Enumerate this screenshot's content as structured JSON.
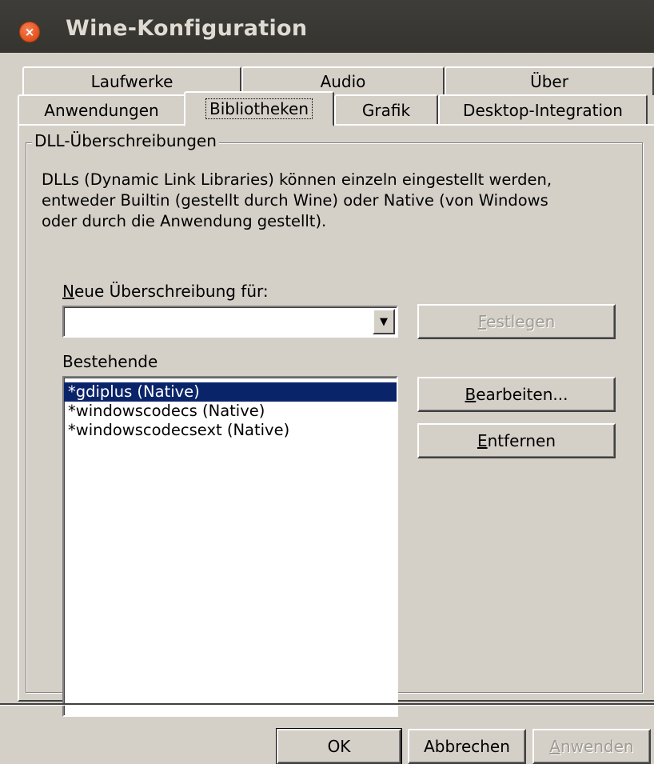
{
  "window": {
    "title": "Wine-Konfiguration",
    "close_glyph": "×",
    "close_color": "#e2511c"
  },
  "tabs": {
    "row1": [
      {
        "label": "Laufwerke"
      },
      {
        "label": "Audio"
      },
      {
        "label": "Über"
      }
    ],
    "row2": [
      {
        "label": "Anwendungen"
      },
      {
        "label": "Bibliotheken",
        "selected": true
      },
      {
        "label": "Grafik"
      },
      {
        "label": "Desktop-Integration"
      }
    ]
  },
  "dll": {
    "group_title": "DLL-Überschreibungen",
    "description": "DLLs (Dynamic Link Libraries) können einzeln eingestellt werden,\nentweder Builtin (gestellt durch Wine) oder Native (von Windows\noder durch die Anwendung gestellt).",
    "new_override_label_mnemonic": "N",
    "new_override_label_rest": "eue Überschreibung für:",
    "combo_value": "",
    "combo_arrow": "▼",
    "set_button_mnemonic": "F",
    "set_button_rest": "estlegen",
    "existing_label": "Bestehende",
    "existing": [
      {
        "label": "*gdiplus (Native)",
        "selected": true
      },
      {
        "label": "*windowscodecs (Native)"
      },
      {
        "label": "*windowscodecsext (Native)"
      }
    ],
    "edit_button_mnemonic": "B",
    "edit_button_rest": "earbeiten...",
    "remove_button_mnemonic": "E",
    "remove_button_rest": "ntfernen"
  },
  "footer": {
    "ok_label": "OK",
    "cancel_label": "Abbrechen",
    "apply_mnemonic": "A",
    "apply_rest": "nwenden"
  },
  "colors": {
    "face": "#d4d0c8",
    "selection": "#0a246a",
    "titlebar": "#3c3b37"
  }
}
